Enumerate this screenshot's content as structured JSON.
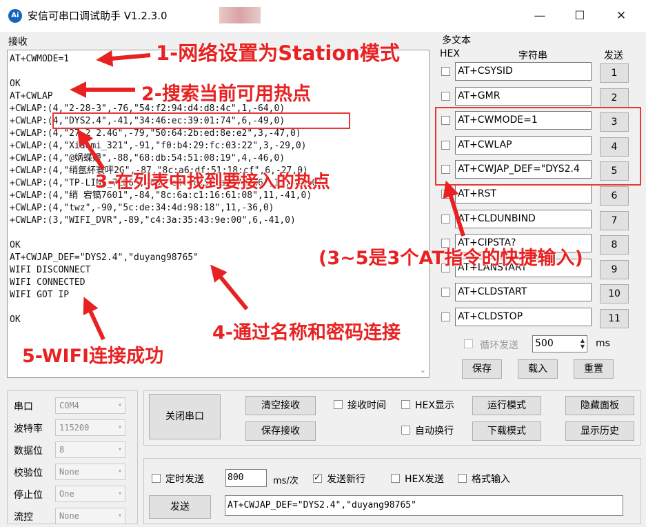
{
  "window": {
    "title": "安信可串口调试助手 V1.2.3.0",
    "icon_text": "Ai",
    "minimize": "—",
    "maximize": "☐",
    "close": "✕"
  },
  "receive": {
    "label": "接收",
    "lines": [
      "AT+CWMODE=1",
      "",
      "OK",
      "AT+CWLAP",
      "+CWLAP:(4,\"2-28-3\",-76,\"54:f2:94:d4:d8:4c\",1,-64,0)",
      "+CWLAP:(4,\"DYS2.4\",-41,\"34:46:ec:39:01:74\",6,-49,0)",
      "+CWLAP:(4,\"27-2 2.4G\",-79,\"50:64:2b:ed:8e:e2\",3,-47,0)",
      "+CWLAP:(4,\"Xiaomi_321\",-91,\"f0:b4:29:fc:03:22\",3,-29,0)",
      "+CWLAP:(4,\"@娲蝶嫚\",-88,\"68:db:54:51:08:19\",4,-46,0)",
      "+CWLAP:(4,\"绡氬紑寰呯2G\",-87,\"8c:a6:df:51:18:cf\",6,-27,0)",
      "+CWLAP:(4,\"TP-LINK_7ED6\",-85,\"e4:c0:5e:a2:7e:d6\",11,-40,0)",
      "+CWLAP:(4,\"绡 宕镐7601\",-84,\"8c:6a:c1:16:61:08\",11,-41,0)",
      "+CWLAP:(4,\"twz\",-90,\"5c:de:34:4d:98:18\",11,-36,0)",
      "+CWLAP:(3,\"WIFI_DVR\",-89,\"c4:3a:35:43:9e:00\",6,-41,0)",
      "",
      "OK",
      "AT+CWJAP_DEF=\"DYS2.4\",\"duyang98765\"",
      "WIFI DISCONNECT",
      "WIFI CONNECTED",
      "WIFI GOT IP",
      "",
      "OK"
    ],
    "scroll_icon": "⌄"
  },
  "annotations": {
    "a1": "1-网络设置为Station模式",
    "a2": "2-搜索当前可用热点",
    "a3": "3-在列表中找到要接入的热点",
    "a4": "4-通过名称和密码连接",
    "a5": "5-WIFI连接成功",
    "a6": "(3~5是3个AT指令的快捷输入)"
  },
  "multi": {
    "label": "多文本",
    "col_hex": "HEX",
    "col_str": "字符串",
    "col_send": "发送",
    "rows": [
      {
        "text": "AT+CSYSID",
        "btn": "1"
      },
      {
        "text": "AT+GMR",
        "btn": "2"
      },
      {
        "text": "AT+CWMODE=1",
        "btn": "3"
      },
      {
        "text": "AT+CWLAP",
        "btn": "4"
      },
      {
        "text": "AT+CWJAP_DEF=\"DYS2.4",
        "btn": "5"
      },
      {
        "text": "AT+RST",
        "btn": "6"
      },
      {
        "text": "AT+CLDUNBIND",
        "btn": "7"
      },
      {
        "text": "AT+CIPSTA?",
        "btn": "8"
      },
      {
        "text": "AT+LANSTART",
        "btn": "9"
      },
      {
        "text": "AT+CLDSTART",
        "btn": "10"
      },
      {
        "text": "AT+CLDSTOP",
        "btn": "11"
      }
    ],
    "loop_label": "循环发送",
    "loop_value": "500",
    "loop_unit": "ms",
    "save": "保存",
    "load": "载入",
    "reset": "重置"
  },
  "serial": {
    "port_label": "串口",
    "port_value": "COM4",
    "baud_label": "波特率",
    "baud_value": "115200",
    "data_label": "数据位",
    "data_value": "8",
    "parity_label": "校验位",
    "parity_value": "None",
    "stop_label": "停止位",
    "stop_value": "One",
    "flow_label": "流控",
    "flow_value": "None"
  },
  "controls": {
    "close_port": "关闭串口",
    "clear_recv": "清空接收",
    "save_recv": "保存接收",
    "recv_time": "接收时间",
    "hex_display": "HEX显示",
    "auto_wrap": "自动换行",
    "run_mode": "运行模式",
    "download_mode": "下载模式",
    "hide_panel": "隐藏面板",
    "show_history": "显示历史"
  },
  "send": {
    "timed_send": "定时发送",
    "interval": "800",
    "interval_unit": "ms/次",
    "send_newline": "发送新行",
    "hex_send": "HEX发送",
    "format_input": "格式输入",
    "send_button": "发送",
    "send_text": "AT+CWJAP_DEF=\"DYS2.4\",\"duyang98765\""
  }
}
